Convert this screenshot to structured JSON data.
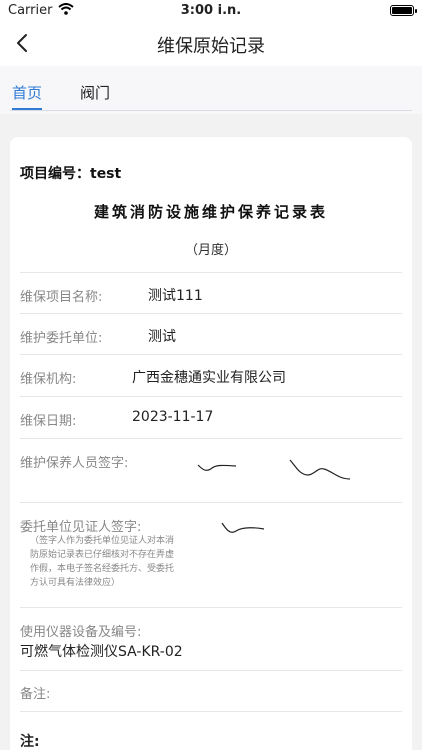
{
  "status_bar": {
    "carrier": "Carrier",
    "time": "3:00 i.n."
  },
  "nav": {
    "title": "维保原始记录"
  },
  "tabs": [
    {
      "label": "首页"
    },
    {
      "label": "阀门"
    }
  ],
  "form": {
    "project_label": "项目编号：test",
    "title": "建筑消防设施维护保养记录表",
    "subtitle": "（月度）",
    "rows": [
      {
        "label": "维保项目名称:",
        "value": "测试111"
      },
      {
        "label": "维护委托单位:",
        "value": "测试"
      },
      {
        "label": "维保机构:",
        "value": "广西金穗通实业有限公司"
      },
      {
        "label": "维保日期:",
        "value": "2023-11-17"
      }
    ],
    "maintainer_sign_label": "维护保养人员签字:",
    "client_sign_label": "委托单位见证人签字:",
    "client_sign_note": "（签字人作为委托单位见证人对本消防原始记录表已仔细核对不存在弄虚作假，本电子签名经委托方、受委托方认可具有法律效应）",
    "instrument_label": "使用仪器设备及编号:",
    "instrument_value": "可燃气体检测仪SA-KR-02",
    "remark_label": "备注:",
    "note_label": "注:"
  }
}
